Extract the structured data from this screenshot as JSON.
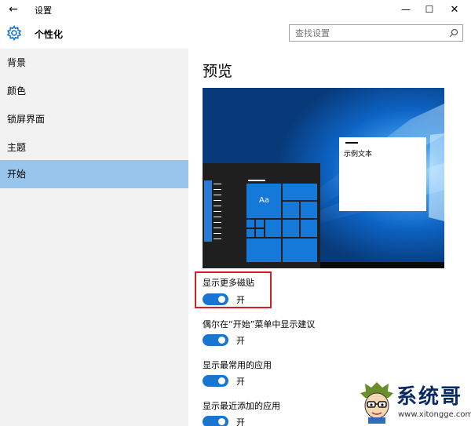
{
  "titlebar": {
    "back_icon": "←",
    "title": "设置",
    "minimize_icon": "—",
    "maximize_icon": "☐",
    "close_icon": "✕"
  },
  "header": {
    "title": "个性化",
    "search_placeholder": "查找设置"
  },
  "sidebar": {
    "items": [
      {
        "label": "背景",
        "active": false
      },
      {
        "label": "颜色",
        "active": false
      },
      {
        "label": "锁屏界面",
        "active": false
      },
      {
        "label": "主题",
        "active": false
      },
      {
        "label": "开始",
        "active": true
      }
    ]
  },
  "main": {
    "preview_heading": "预览",
    "preview": {
      "sample_text": "示例文本",
      "tile_label": "Aa"
    },
    "options": [
      {
        "label": "显示更多磁贴",
        "state": "开",
        "on": true,
        "highlighted": true
      },
      {
        "label": "偶尔在“开始”菜单中显示建议",
        "state": "开",
        "on": true,
        "highlighted": false
      },
      {
        "label": "显示最常用的应用",
        "state": "开",
        "on": true,
        "highlighted": false
      },
      {
        "label": "显示最近添加的应用",
        "state": "开",
        "on": true,
        "highlighted": false
      }
    ]
  },
  "colors": {
    "accent": "#1875d1",
    "nav_active": "#98c5eb",
    "sidebar_bg": "#f2f2f2",
    "highlight_border": "#d11f25"
  },
  "watermark": {
    "name": "系统哥",
    "domain": "www.xitongge.com"
  }
}
